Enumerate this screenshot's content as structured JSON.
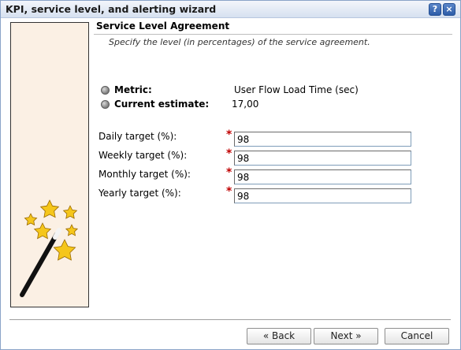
{
  "window": {
    "title": "KPI, service level, and alerting wizard",
    "help_label": "?",
    "close_label": "×"
  },
  "section": {
    "title": "Service Level Agreement",
    "subtitle": "Specify the level (in percentages) of the service agreement."
  },
  "info": {
    "metric_label": "Metric:",
    "metric_value": "User Flow Load Time (sec)",
    "estimate_label": "Current estimate:",
    "estimate_value": "17,00"
  },
  "targets": {
    "required_mark": "*",
    "daily_label": "Daily target (%):",
    "daily_value": "98",
    "weekly_label": "Weekly target (%):",
    "weekly_value": "98",
    "monthly_label": "Monthly target (%):",
    "monthly_value": "98",
    "yearly_label": "Yearly target (%):",
    "yearly_value": "98"
  },
  "buttons": {
    "back": "« Back",
    "next": "Next »",
    "cancel": "Cancel"
  },
  "colors": {
    "star_fill": "#f5c61b",
    "side_panel_bg": "#fbf0e4",
    "required": "#c00000",
    "titlebar_button": "#2d5da8"
  },
  "icons": {
    "side_art": "magic-wand-stars-icon",
    "bullet": "bullet-icon",
    "help": "help-icon",
    "close": "close-icon"
  }
}
